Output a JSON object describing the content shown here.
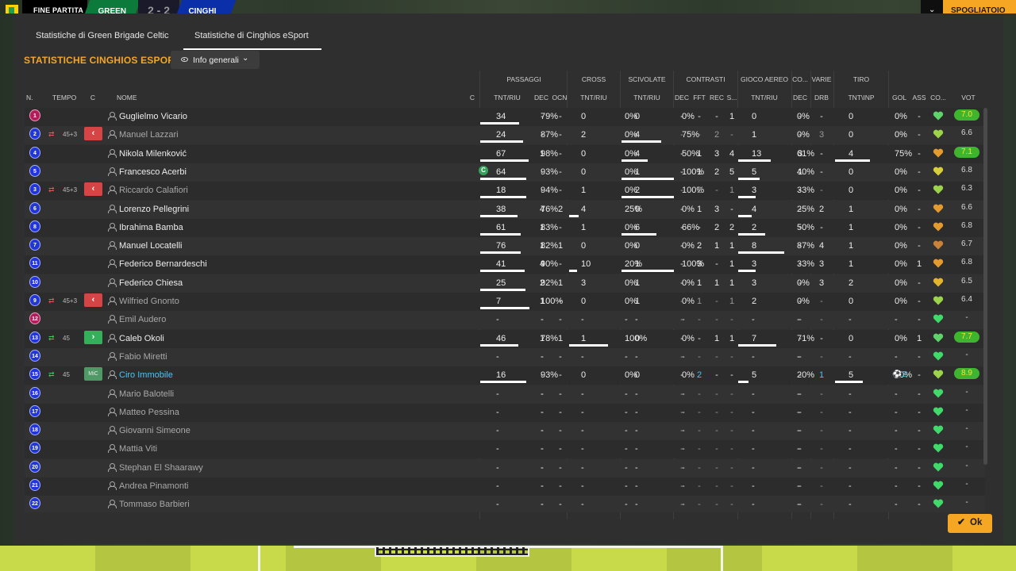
{
  "topbar": {
    "status": "FINE PARTITA",
    "home_team": "GREEN",
    "score": "2 - 2",
    "away_team": "CINGHI",
    "right_button": "SPOGLIATOIO",
    "collapse_icon": "chevron-down-icon"
  },
  "tabs": [
    {
      "label": "Statistiche di Green Brigade Celtic"
    },
    {
      "label": "Statistiche di Cinghios eSport",
      "active": true
    }
  ],
  "section_title": "STATISTICHE CINGHIOS ESPORT",
  "view_dropdown": {
    "label": "Info generali",
    "icon": "eye-icon"
  },
  "groups": [
    "PASSAGGI",
    "CROSS",
    "SCIVOLATE",
    "CONTRASTI",
    "GIOCO AEREO",
    "CO...",
    "VARIE",
    "TIRO"
  ],
  "headers": [
    "N.",
    "TEMPO",
    "C",
    "NOME",
    "C",
    "TNT/RIU",
    "DEC",
    "OCN",
    "TNT/RIU",
    "TNT/RIU",
    "DEC",
    "FFT",
    "REC",
    "S...",
    "TNT/RIU",
    "DEC",
    "DRB",
    "TNT\\INP",
    "GOL",
    "ASS",
    "CO...",
    "VOT"
  ],
  "players": [
    {
      "n": "1",
      "gk": true,
      "name": "Guglielmo Vicario",
      "pa": "34",
      "pp": "79%",
      "pad": "-",
      "pao": "-",
      "cra": "0",
      "crp": "0%",
      "sca": "0",
      "scp": "0%",
      "cd": "-",
      "cf": "-",
      "cr": "-",
      "cs": "1",
      "gaa": "0",
      "gap": "0%",
      "cod": "-",
      "drb": "-",
      "ta": "0",
      "tp": "0%",
      "gol": "",
      "ass": "-",
      "hc": "#5fd36a",
      "vot": "7.0",
      "hl": true
    },
    {
      "n": "2",
      "sub": "out",
      "time": "45+3",
      "name": "Manuel Lazzari",
      "dim": true,
      "pa": "24",
      "pp": "87%",
      "pad": "-",
      "pao": "-",
      "cra": "2",
      "crp": "0%",
      "sca": "4",
      "scp": "75%",
      "cd": "-",
      "cf": "-",
      "cr": "2",
      "cs": "-",
      "gaa": "1",
      "gap": "0%",
      "cod": "-",
      "drb": "3",
      "ta": "0",
      "tp": "0%",
      "gol": "",
      "ass": "-",
      "hc": "#9cd34a",
      "vot": "6.6"
    },
    {
      "n": "4",
      "name": "Nikola Milenković",
      "pa": "67",
      "pp": "98%",
      "pad": "1",
      "pao": "-",
      "cra": "0",
      "crp": "0%",
      "sca": "4",
      "scp": "50%",
      "cd": "-",
      "cf": "1",
      "cr": "3",
      "cs": "4",
      "gaa": "13",
      "gap": "61%",
      "cod": "3",
      "drb": "-",
      "ta": "4",
      "tp": "75%",
      "gol": "",
      "ass": "-",
      "hc": "#e39a2e",
      "vot": "7.1",
      "hl": true
    },
    {
      "n": "5",
      "name": "Francesco Acerbi",
      "cap": true,
      "pa": "64",
      "pp": "93%",
      "pad": "-",
      "pao": "-",
      "cra": "0",
      "crp": "0%",
      "sca": "1",
      "scp": "100%",
      "cd": "-",
      "cf": "1",
      "cr": "2",
      "cs": "5",
      "gaa": "5",
      "gap": "40%",
      "cod": "1",
      "drb": "-",
      "ta": "0",
      "tp": "0%",
      "gol": "",
      "ass": "-",
      "hc": "#d7cf3a",
      "vot": "6.8"
    },
    {
      "n": "3",
      "sub": "out",
      "time": "45+3",
      "name": "Riccardo Calafiori",
      "dim": true,
      "pa": "18",
      "pp": "94%",
      "pad": "-",
      "pao": "-",
      "cra": "1",
      "crp": "0%",
      "sca": "2",
      "scp": "100%",
      "cd": "-",
      "cf": "2",
      "cr": "-",
      "cs": "1",
      "gaa": "3",
      "gap": "33%",
      "cod": "-",
      "drb": "-",
      "ta": "0",
      "tp": "0%",
      "gol": "",
      "ass": "-",
      "hc": "#9cd34a",
      "vot": "6.3"
    },
    {
      "n": "6",
      "name": "Lorenzo Pellegrini",
      "pa": "38",
      "pp": "76%",
      "pad": "4",
      "pao": "2",
      "cra": "4",
      "crp": "25%",
      "sca": "0",
      "scp": "0%",
      "cd": "-",
      "cf": "1",
      "cr": "3",
      "cs": "-",
      "gaa": "4",
      "gap": "25%",
      "cod": "-",
      "drb": "2",
      "ta": "1",
      "tp": "0%",
      "gol": "",
      "ass": "-",
      "hc": "#e39a2e",
      "vot": "6.6"
    },
    {
      "n": "8",
      "name": "Ibrahima Bamba",
      "pa": "61",
      "pp": "83%",
      "pad": "1",
      "pao": "-",
      "cra": "1",
      "crp": "0%",
      "sca": "6",
      "scp": "66%",
      "cd": "-",
      "cf": "-",
      "cr": "2",
      "cs": "2",
      "gaa": "2",
      "gap": "50%",
      "cod": "-",
      "drb": "-",
      "ta": "1",
      "tp": "0%",
      "gol": "",
      "ass": "-",
      "hc": "#e39a2e",
      "vot": "6.8"
    },
    {
      "n": "7",
      "name": "Manuel Locatelli",
      "pa": "76",
      "pp": "82%",
      "pad": "1",
      "pao": "1",
      "cra": "0",
      "crp": "0%",
      "sca": "0",
      "scp": "0%",
      "cd": "-",
      "cf": "2",
      "cr": "1",
      "cs": "1",
      "gaa": "8",
      "gap": "87%",
      "cod": "-",
      "drb": "4",
      "ta": "1",
      "tp": "0%",
      "gol": "",
      "ass": "-",
      "hc": "#c8823c",
      "vot": "6.7"
    },
    {
      "n": "11",
      "name": "Federico Bernardeschi",
      "pa": "41",
      "pp": "90%",
      "pad": "4",
      "pao": "-",
      "cra": "10",
      "crp": "20%",
      "sca": "1",
      "scp": "100%",
      "cd": "-",
      "cf": "3",
      "cr": "-",
      "cs": "1",
      "gaa": "3",
      "gap": "33%",
      "cod": "-",
      "drb": "3",
      "ta": "1",
      "tp": "0%",
      "gol": "",
      "ass": "1",
      "hc": "#e39a2e",
      "vot": "6.8"
    },
    {
      "n": "10",
      "name": "Federico Chiesa",
      "pa": "25",
      "pp": "92%",
      "pad": "2",
      "pao": "1",
      "cra": "3",
      "crp": "0%",
      "sca": "1",
      "scp": "0%",
      "cd": "-",
      "cf": "1",
      "cr": "1",
      "cs": "1",
      "gaa": "3",
      "gap": "0%",
      "cod": "-",
      "drb": "3",
      "ta": "2",
      "tp": "0%",
      "gol": "",
      "ass": "-",
      "hc": "#e3b52e",
      "vot": "6.5"
    },
    {
      "n": "9",
      "sub": "out",
      "time": "45+3",
      "name": "Wilfried Gnonto",
      "dim": true,
      "pa": "7",
      "pp": "100%",
      "pad": "1",
      "pao": "-",
      "cra": "0",
      "crp": "0%",
      "sca": "1",
      "scp": "0%",
      "cd": "-",
      "cf": "1",
      "cr": "-",
      "cs": "1",
      "gaa": "2",
      "gap": "0%",
      "cod": "-",
      "drb": "-",
      "ta": "0",
      "tp": "0%",
      "gol": "",
      "ass": "-",
      "hc": "#9cd34a",
      "vot": "6.4"
    },
    {
      "n": "12",
      "gk": true,
      "name": "Emil Audero",
      "dim": true,
      "pa": "-",
      "pp": "-",
      "pad": "-",
      "pao": "-",
      "cra": "-",
      "crp": "-",
      "sca": "-",
      "scp": "-",
      "cd": "-",
      "cf": "-",
      "cr": "-",
      "cs": "-",
      "gaa": "-",
      "gap": "-",
      "cod": "-",
      "drb": "-",
      "ta": "-",
      "tp": "-",
      "gol": "",
      "ass": "-",
      "hc": "#41d96a",
      "vot": "-"
    },
    {
      "n": "13",
      "sub": "in",
      "time": "45",
      "name": "Caleb Okoli",
      "pa": "46",
      "pp": "78%",
      "pad": "1",
      "pao": "1",
      "cra": "1",
      "crp": "100%",
      "sca": "0",
      "scp": "0%",
      "cd": "-",
      "cf": "-",
      "cr": "1",
      "cs": "1",
      "gaa": "7",
      "gap": "71%",
      "cod": "-",
      "drb": "-",
      "ta": "0",
      "tp": "0%",
      "gol": "",
      "ass": "1",
      "hc": "#5fd36a",
      "vot": "7.7",
      "hl": true
    },
    {
      "n": "14",
      "name": "Fabio Miretti",
      "dim": true,
      "pa": "-",
      "pp": "-",
      "pad": "-",
      "pao": "-",
      "cra": "-",
      "crp": "-",
      "sca": "-",
      "scp": "-",
      "cd": "-",
      "cf": "-",
      "cr": "-",
      "cs": "-",
      "gaa": "-",
      "gap": "-",
      "cod": "-",
      "drb": "-",
      "ta": "-",
      "tp": "-",
      "gol": "",
      "ass": "-",
      "hc": "#41d96a",
      "vot": "-"
    },
    {
      "n": "15",
      "sub": "in",
      "time": "45",
      "pos": "MiC",
      "name": "Ciro Immobile",
      "blue": true,
      "pa": "16",
      "pp": "93%",
      "pad": "-",
      "pao": "-",
      "cra": "0",
      "crp": "0%",
      "sca": "0",
      "scp": "0%",
      "cd": "-",
      "cf": "2",
      "cr": "-",
      "cs": "-",
      "gaa": "5",
      "gap": "20%",
      "cod": "-",
      "drb": "1",
      "ta": "5",
      "tp": "60%",
      "gol": "2",
      "ass": "-",
      "hc": "#9cd34a",
      "vot": "8.9",
      "hl": true
    },
    {
      "n": "16",
      "name": "Mario Balotelli",
      "dim": true,
      "pa": "-",
      "pp": "-",
      "pad": "-",
      "pao": "-",
      "cra": "-",
      "crp": "-",
      "sca": "-",
      "scp": "-",
      "cd": "-",
      "cf": "-",
      "cr": "-",
      "cs": "-",
      "gaa": "-",
      "gap": "-",
      "cod": "-",
      "drb": "-",
      "ta": "-",
      "tp": "-",
      "gol": "",
      "ass": "-",
      "hc": "#41d96a",
      "vot": "-"
    },
    {
      "n": "17",
      "name": "Matteo Pessina",
      "dim": true,
      "pa": "-",
      "pp": "-",
      "pad": "-",
      "pao": "-",
      "cra": "-",
      "crp": "-",
      "sca": "-",
      "scp": "-",
      "cd": "-",
      "cf": "-",
      "cr": "-",
      "cs": "-",
      "gaa": "-",
      "gap": "-",
      "cod": "-",
      "drb": "-",
      "ta": "-",
      "tp": "-",
      "gol": "",
      "ass": "-",
      "hc": "#41d96a",
      "vot": "-"
    },
    {
      "n": "18",
      "name": "Giovanni Simeone",
      "dim": true,
      "pa": "-",
      "pp": "-",
      "pad": "-",
      "pao": "-",
      "cra": "-",
      "crp": "-",
      "sca": "-",
      "scp": "-",
      "cd": "-",
      "cf": "-",
      "cr": "-",
      "cs": "-",
      "gaa": "-",
      "gap": "-",
      "cod": "-",
      "drb": "-",
      "ta": "-",
      "tp": "-",
      "gol": "",
      "ass": "-",
      "hc": "#41d96a",
      "vot": "-"
    },
    {
      "n": "19",
      "name": "Mattia Viti",
      "dim": true,
      "pa": "-",
      "pp": "-",
      "pad": "-",
      "pao": "-",
      "cra": "-",
      "crp": "-",
      "sca": "-",
      "scp": "-",
      "cd": "-",
      "cf": "-",
      "cr": "-",
      "cs": "-",
      "gaa": "-",
      "gap": "-",
      "cod": "-",
      "drb": "-",
      "ta": "-",
      "tp": "-",
      "gol": "",
      "ass": "-",
      "hc": "#41d96a",
      "vot": "-"
    },
    {
      "n": "20",
      "name": "Stephan El Shaarawy",
      "dim": true,
      "pa": "-",
      "pp": "-",
      "pad": "-",
      "pao": "-",
      "cra": "-",
      "crp": "-",
      "sca": "-",
      "scp": "-",
      "cd": "-",
      "cf": "-",
      "cr": "-",
      "cs": "-",
      "gaa": "-",
      "gap": "-",
      "cod": "-",
      "drb": "-",
      "ta": "-",
      "tp": "-",
      "gol": "",
      "ass": "-",
      "hc": "#41d96a",
      "vot": "-"
    },
    {
      "n": "21",
      "name": "Andrea Pinamonti",
      "dim": true,
      "pa": "-",
      "pp": "-",
      "pad": "-",
      "pao": "-",
      "cra": "-",
      "crp": "-",
      "sca": "-",
      "scp": "-",
      "cd": "-",
      "cf": "-",
      "cr": "-",
      "cs": "-",
      "gaa": "-",
      "gap": "-",
      "cod": "-",
      "drb": "-",
      "ta": "-",
      "tp": "-",
      "gol": "",
      "ass": "-",
      "hc": "#41d96a",
      "vot": "-"
    },
    {
      "n": "22",
      "name": "Tommaso Barbieri",
      "dim": true,
      "pa": "-",
      "pp": "-",
      "pad": "-",
      "pao": "-",
      "cra": "-",
      "crp": "-",
      "sca": "-",
      "scp": "-",
      "cd": "-",
      "cf": "-",
      "cr": "-",
      "cs": "-",
      "gaa": "-",
      "gap": "-",
      "cod": "-",
      "drb": "-",
      "ta": "-",
      "tp": "-",
      "gol": "",
      "ass": "-",
      "hc": "#41d96a",
      "vot": "-"
    }
  ],
  "ok_button": {
    "label": "Ok",
    "icon": "check-icon"
  }
}
